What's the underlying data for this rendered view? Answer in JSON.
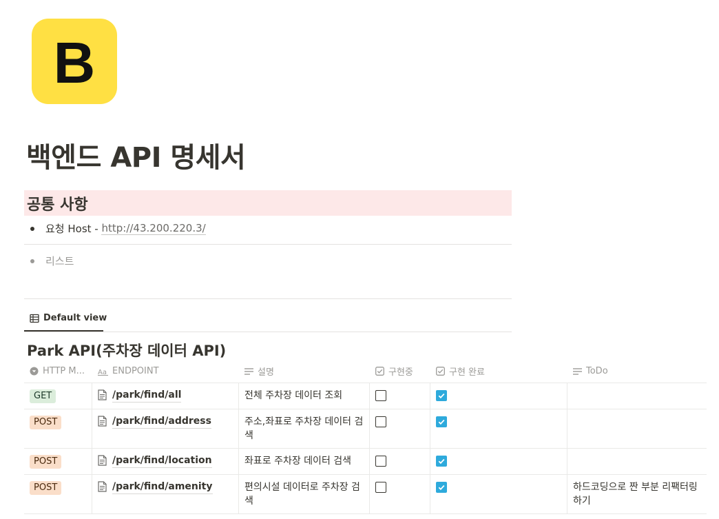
{
  "page": {
    "icon_letter": "B",
    "title": "백엔드 API 명세서"
  },
  "callout": {
    "heading": "공통 사항"
  },
  "bullets": [
    {
      "label": "요청 Host - ",
      "link": "http://43.200.220.3/"
    },
    {
      "label": "리스트"
    }
  ],
  "view_tab": {
    "label": "Default view",
    "icon": "table-icon"
  },
  "database": {
    "title": "Park API(주차장 데이터 API)",
    "columns": [
      {
        "label": "HTTP M...",
        "icon": "select-icon"
      },
      {
        "label": "ENDPOINT",
        "icon": "title-aa-icon"
      },
      {
        "label": "설명",
        "icon": "text-lines-icon"
      },
      {
        "label": "구현중",
        "icon": "checkbox-icon"
      },
      {
        "label": "구현 완료",
        "icon": "checkbox-icon"
      },
      {
        "label": "ToDo",
        "icon": "text-lines-icon"
      }
    ],
    "rows": [
      {
        "method": "GET",
        "endpoint": "/park/find/all",
        "desc": "전체 주차장 데이터 조회",
        "in_progress": false,
        "done": true,
        "todo": ""
      },
      {
        "method": "POST",
        "endpoint": "/park/find/address",
        "desc": "주소,좌표로 주차장 데이터 검색",
        "in_progress": false,
        "done": true,
        "todo": ""
      },
      {
        "method": "POST",
        "endpoint": "/park/find/location",
        "desc": "좌표로 주차장 데이터 검색",
        "in_progress": false,
        "done": true,
        "todo": ""
      },
      {
        "method": "POST",
        "endpoint": "/park/find/amenity",
        "desc": "편의시설 데이터로 주차장 검색",
        "in_progress": false,
        "done": true,
        "todo": "하드코딩으로 짠 부분 리팩터링하기"
      }
    ]
  },
  "colors": {
    "callout_bg": "#fde8e8",
    "get_tag": "#dbeddb",
    "post_tag": "#fadec9",
    "checkbox_checked": "#2eaadc",
    "icon_bg": "#ffe043"
  }
}
